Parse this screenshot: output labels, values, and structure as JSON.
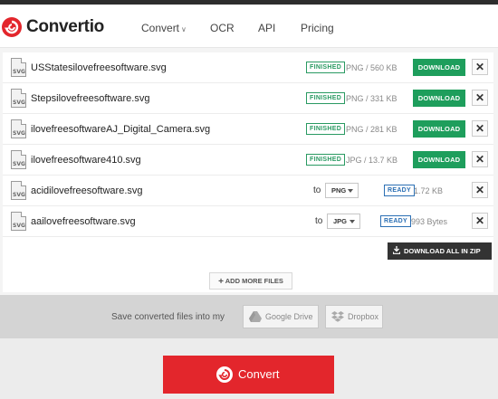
{
  "brand": {
    "name": "Convertio",
    "accent": "#e3262c"
  },
  "nav": {
    "convert": "Convert",
    "ocr": "OCR",
    "api": "API",
    "pricing": "Pricing"
  },
  "files": [
    {
      "name": "USStatesilovefreesoftware.svg",
      "status": "FINISHED",
      "info": "PNG / 560 KB",
      "action": "DOWNLOAD"
    },
    {
      "name": "Stepsilovefreesoftware.svg",
      "status": "FINISHED",
      "info": "PNG / 331 KB",
      "action": "DOWNLOAD"
    },
    {
      "name": "ilovefreesoftwareAJ_Digital_Camera.svg",
      "status": "FINISHED",
      "info": "PNG / 281 KB",
      "action": "DOWNLOAD"
    },
    {
      "name": "ilovefreesoftware410.svg",
      "status": "FINISHED",
      "info": "JPG / 13.7 KB",
      "action": "DOWNLOAD"
    },
    {
      "name": "acidilovefreesoftware.svg",
      "to": "to",
      "format": "PNG",
      "status": "READY",
      "size": "1.72 KB"
    },
    {
      "name": "aailovefreesoftware.svg",
      "to": "to",
      "format": "JPG",
      "status": "READY",
      "size": "993 Bytes"
    }
  ],
  "file_icon_text": "SVG",
  "remove_symbol": "✕",
  "download_all": "DOWNLOAD ALL IN ZIP",
  "add_more": "ADD MORE FILES",
  "save": {
    "text": "Save converted files into my",
    "google_drive": "Google Drive",
    "dropbox": "Dropbox"
  },
  "convert_button": "Convert",
  "colors": {
    "download": "#1e9e5c",
    "finished": "#2a9a62",
    "ready": "#2b6fb4"
  }
}
